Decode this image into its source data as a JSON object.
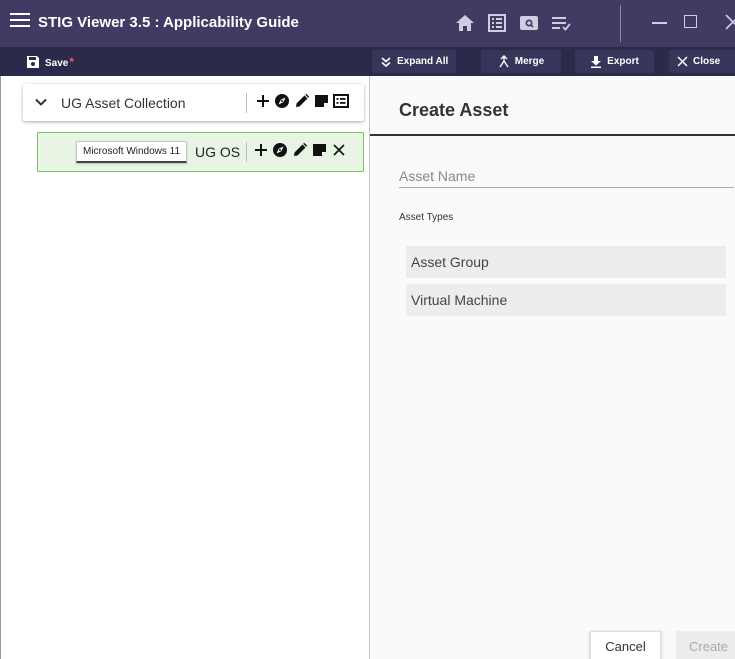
{
  "window": {
    "title": "STIG Viewer 3.5 : Applicability Guide",
    "icons": [
      "home-icon",
      "checklist-icon",
      "search-box-icon",
      "filter-list-icon"
    ]
  },
  "toolbar": {
    "save_label": "Save",
    "save_dirty_marker": "*",
    "expand_all_label": "Expand All",
    "merge_label": "Merge",
    "export_label": "Export",
    "close_label": "Close"
  },
  "tree": {
    "collection": {
      "name": "UG Asset Collection",
      "actions": [
        "add-icon",
        "compass-icon",
        "edit-icon",
        "note-icon",
        "list-icon"
      ]
    },
    "asset": {
      "tag": "Microsoft Windows 11",
      "name": "UG OS",
      "actions": [
        "add-icon",
        "compass-icon",
        "edit-icon",
        "note-icon",
        "remove-icon"
      ]
    }
  },
  "create_panel": {
    "title": "Create Asset",
    "name_placeholder": "Asset Name",
    "name_value": "",
    "types_label": "Asset Types",
    "types": [
      "Asset Group",
      "Virtual Machine"
    ],
    "cancel_label": "Cancel",
    "create_label": "Create"
  },
  "colors": {
    "titlebar": "#3f3b63",
    "toolbar": "#2c2a4a",
    "save_marker": "#ff4f6a",
    "selected_row_bg": "#e8f5e4",
    "selected_row_border": "#7cc36b"
  }
}
